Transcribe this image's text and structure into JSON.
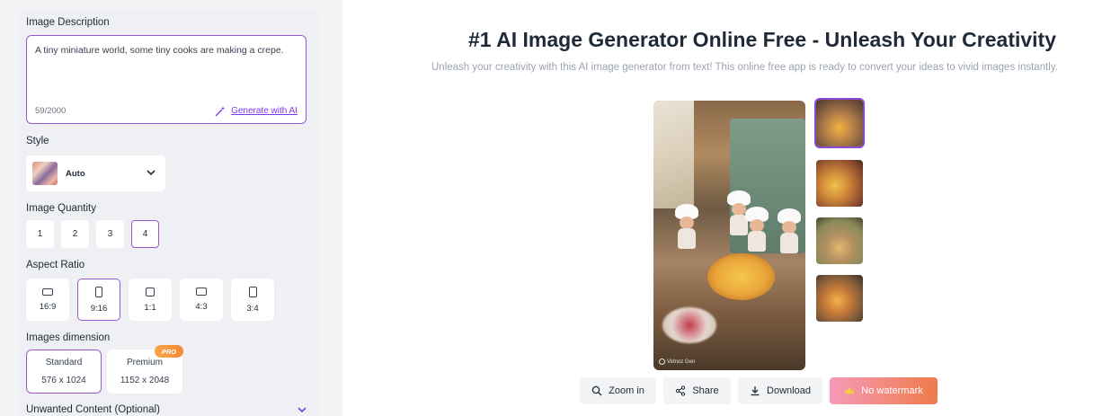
{
  "left": {
    "description_label": "Image Description",
    "description_text": "A tiny miniature world, some tiny cooks are making a crepe.",
    "char_count": "59/2000",
    "generate_ai_label": "Generate with AI",
    "style_label": "Style",
    "style_value": "Auto",
    "quantity_label": "Image Quantity",
    "quantities": [
      "1",
      "2",
      "3",
      "4"
    ],
    "quantity_selected": "4",
    "aspect_label": "Aspect Ratio",
    "ratios": [
      "16:9",
      "9:16",
      "1:1",
      "4:3",
      "3:4"
    ],
    "ratio_selected": "9:16",
    "dimension_label": "Images dimension",
    "dimensions": [
      {
        "name": "Standard",
        "size": "576 x 1024"
      },
      {
        "name": "Premium",
        "size": "1152 x 2048"
      }
    ],
    "dimension_selected": "Standard",
    "pro_badge": "PRO",
    "unwanted_label": "Unwanted Content (Optional)"
  },
  "right": {
    "title": "#1 AI Image Generator Online Free - Unleash Your Creativity",
    "subtitle": "Unleash your creativity with this AI image generator from text! This online free app is ready to convert your ideas to vivid images instantly.",
    "watermark": "Vidnoz Gen",
    "actions": {
      "zoom": "Zoom in",
      "share": "Share",
      "download": "Download",
      "no_watermark": "No watermark"
    }
  },
  "colors": {
    "accent": "#9b59d0",
    "link": "#7c3aed",
    "no_watermark_start": "#f69ab8",
    "no_watermark_end": "#f17a4a"
  }
}
